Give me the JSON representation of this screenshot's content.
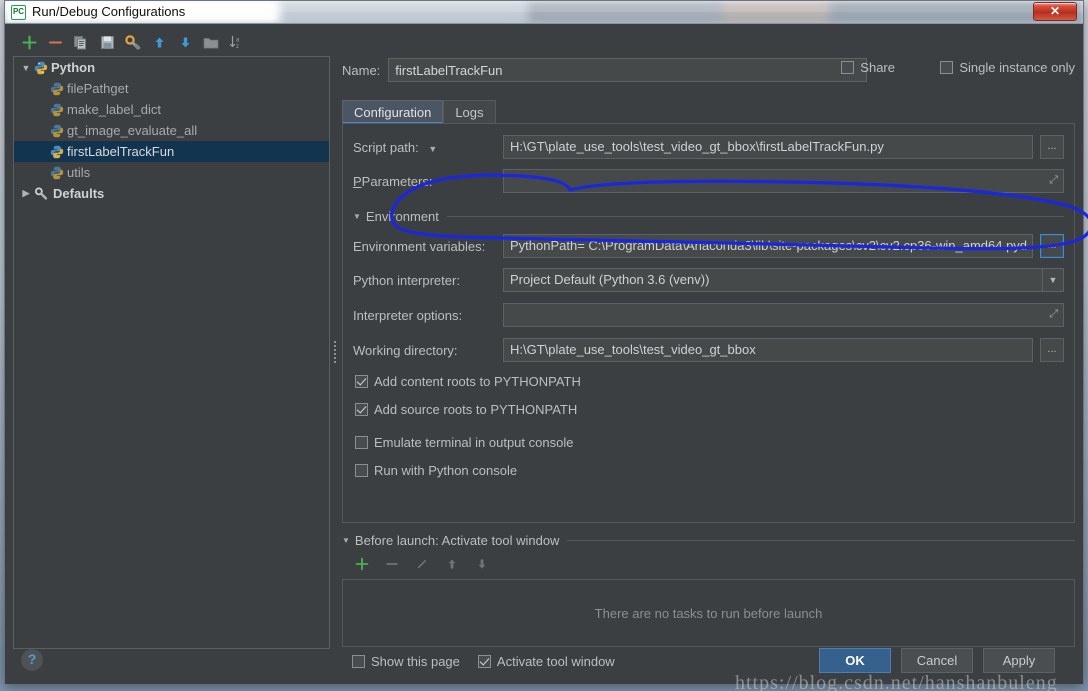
{
  "window": {
    "title": "Run/Debug Configurations",
    "app_icon": "PC",
    "close_label": "✕"
  },
  "toolbar": {
    "items": [
      {
        "name": "add-icon",
        "tooltip": "Add New Configuration"
      },
      {
        "name": "remove-icon",
        "tooltip": "Remove Configuration"
      },
      {
        "name": "copy-icon",
        "tooltip": "Copy Configuration"
      },
      {
        "name": "save-icon",
        "tooltip": "Save Configuration"
      },
      {
        "name": "edit-defaults-icon",
        "tooltip": "Edit defaults"
      },
      {
        "name": "move-up-icon",
        "tooltip": "Move Up"
      },
      {
        "name": "move-down-icon",
        "tooltip": "Move Down"
      },
      {
        "name": "new-folder-icon",
        "tooltip": "Create New Folder"
      },
      {
        "name": "sort-alphabetically-icon",
        "tooltip": "Sort Configurations"
      }
    ]
  },
  "tree": {
    "groups": [
      {
        "label": "Python",
        "expanded": true,
        "twisty": "▼",
        "children": [
          {
            "label": "filePathget",
            "selected": false
          },
          {
            "label": "make_label_dict",
            "selected": false
          },
          {
            "label": "gt_image_evaluate_all",
            "selected": false
          },
          {
            "label": "firstLabelTrackFun",
            "selected": true
          },
          {
            "label": "utils",
            "selected": false
          }
        ]
      },
      {
        "label": "Defaults",
        "expanded": false,
        "twisty": "▶",
        "children": []
      }
    ]
  },
  "name_row": {
    "label": "Name:",
    "value": "firstLabelTrackFun",
    "placeholder": "",
    "share": {
      "label": "Share",
      "checked": false
    },
    "single_instance": {
      "label": "Single instance only",
      "checked": false
    }
  },
  "tabs": [
    {
      "label": "Configuration",
      "active": true
    },
    {
      "label": "Logs",
      "active": false
    }
  ],
  "form": {
    "script_path": {
      "label": "Script path:",
      "value": "H:\\GT\\plate_use_tools\\test_video_gt_bbox\\firstLabelTrackFun.py",
      "browse": "...",
      "caret": "▼"
    },
    "parameters": {
      "label": "Parameters:",
      "value": "",
      "expand": "⤢"
    },
    "environment_section": {
      "label": "Environment",
      "tri": "▼"
    },
    "environment_variables": {
      "label": "Environment variables:",
      "value": "PythonPath= C:\\ProgramData\\Anaconda3\\lib\\site-packages\\cv2\\cv2.cp36-win_amd64.pyd",
      "browse": "..."
    },
    "python_interpreter": {
      "label": "Python interpreter:",
      "value": "Project Default (Python 3.6 (venv))",
      "arrow": "▼"
    },
    "interpreter_options": {
      "label": "Interpreter options:",
      "value": "",
      "expand": "⤢"
    },
    "working_directory": {
      "label": "Working directory:",
      "value": "H:\\GT\\plate_use_tools\\test_video_gt_bbox",
      "browse": "..."
    },
    "checkboxes": [
      {
        "label": "Add content roots to PYTHONPATH",
        "checked": true
      },
      {
        "label": "Add source roots to PYTHONPATH",
        "checked": true
      },
      {
        "label": "Emulate terminal in output console",
        "checked": false
      },
      {
        "label": "Run with Python console",
        "checked": false
      }
    ]
  },
  "before_launch": {
    "header": "Before launch: Activate tool window",
    "tri": "▼",
    "toolbar": [
      {
        "name": "add-task-icon",
        "enabled": true
      },
      {
        "name": "remove-task-icon",
        "enabled": false
      },
      {
        "name": "edit-task-icon",
        "enabled": false
      },
      {
        "name": "task-move-up-icon",
        "enabled": false
      },
      {
        "name": "task-move-down-icon",
        "enabled": false
      }
    ],
    "empty_text": "There are no tasks to run before launch",
    "bottom_checks": [
      {
        "label": "Show this page",
        "checked": false
      },
      {
        "label": "Activate tool window",
        "checked": true
      }
    ]
  },
  "footer": {
    "help": "?",
    "ok": "OK",
    "cancel": "Cancel",
    "apply": "Apply"
  },
  "watermark": "https://blog.csdn.net/hanshanbuleng",
  "annotation": {
    "type": "hand-drawn-ellipse",
    "color": "#1a26e0",
    "target": "environment-variables-row"
  },
  "colors": {
    "accent": "#4a88c7",
    "selection": "#12344f",
    "panel_bg": "#3c3f41",
    "field_bg": "#45494a",
    "annotation_blue": "#1a26e0",
    "primary_button": "#36618e"
  }
}
